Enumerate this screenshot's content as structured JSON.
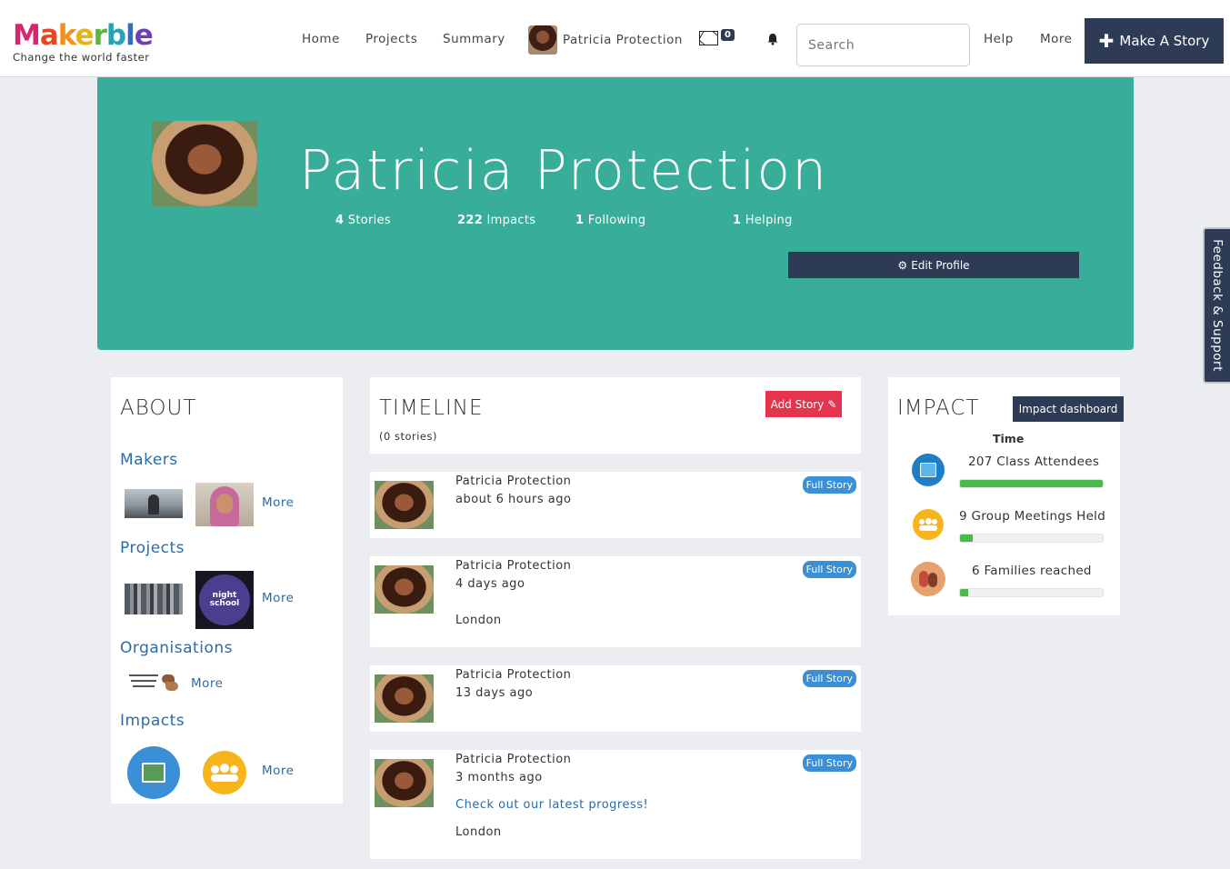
{
  "brand": {
    "logo_text": [
      "M",
      "a",
      "k",
      "e",
      "r",
      "b",
      "l",
      "e"
    ],
    "tagline": "Change the world faster"
  },
  "nav": {
    "home": "Home",
    "projects": "Projects",
    "summary": "Summary",
    "user_name": "Patricia Protection",
    "messages_count": "0",
    "search_placeholder": "Search",
    "help": "Help",
    "more": "More",
    "make_story": "Make A Story"
  },
  "profile": {
    "name": "Patricia Protection",
    "stats": [
      {
        "value": "4",
        "label": "Stories"
      },
      {
        "value": "222",
        "label": "Impacts"
      },
      {
        "value": "1",
        "label": "Following"
      },
      {
        "value": "1",
        "label": "Helping"
      }
    ],
    "edit_label": "Edit Profile"
  },
  "feedback_label": "Feedback & Support",
  "about": {
    "title": "ABOUT",
    "makers": "Makers",
    "projects": "Projects",
    "organisations": "Organisations",
    "impacts": "Impacts",
    "more": "More",
    "night_school": "night school"
  },
  "timeline": {
    "title": "TIMELINE",
    "count": "(0 stories)",
    "add_story": "Add Story",
    "full_story": "Full Story",
    "posts": [
      {
        "author": "Patricia Protection",
        "time": "about 6 hours ago",
        "link": "",
        "location": ""
      },
      {
        "author": "Patricia Protection",
        "time": "4 days ago",
        "link": "",
        "location": "London"
      },
      {
        "author": "Patricia Protection",
        "time": "13 days ago",
        "link": "",
        "location": ""
      },
      {
        "author": "Patricia Protection",
        "time": "3 months ago",
        "link": "Check out our latest progress!",
        "location": "London"
      }
    ]
  },
  "impact": {
    "title": "IMPACT",
    "dashboard": "Impact dashboard",
    "group_label": "Time",
    "items": [
      {
        "label": "207 Class Attendees",
        "progress": 1.0
      },
      {
        "label": "9 Group Meetings Held",
        "progress": 0.09
      },
      {
        "label": "6 Families reached",
        "progress": 0.06
      }
    ]
  },
  "colors": {
    "hero": "#38ad99",
    "navy": "#2d3b55",
    "accent_red": "#e5344e",
    "link_blue": "#2a6ca8",
    "progress_green": "#4cb84c"
  }
}
